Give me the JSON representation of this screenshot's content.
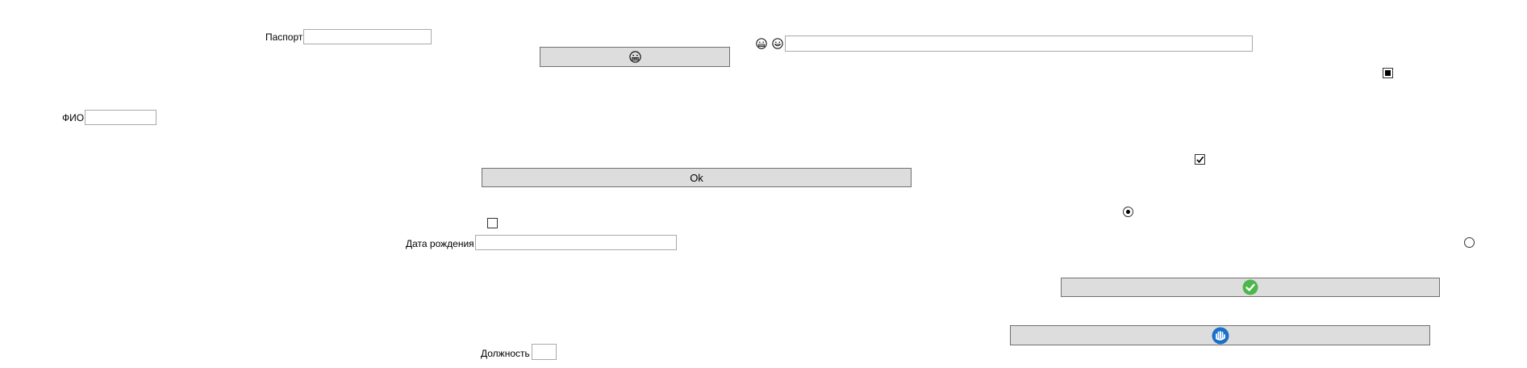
{
  "form": {
    "passport_label": "Паспорт",
    "passport_value": "",
    "fio_label": "ФИО",
    "fio_value": "",
    "birthdate_label": "Дата рождения",
    "birthdate_value": "",
    "position_label": "Должность",
    "position_value": "",
    "top_text_value": ""
  },
  "buttons": {
    "ok_label": "Ok",
    "emoji_button_icon": "grimacing-face-icon",
    "check_button_icon": "green-check-circle-icon",
    "hand_button_icon": "blue-hand-circle-icon"
  },
  "indicators": {
    "top_emoji_icons": [
      "grimacing-face-icon",
      "grinning-face-icon"
    ]
  },
  "toggles": {
    "square_checkbox_checked": true,
    "tick_checkbox_checked": true,
    "empty_checkbox_checked": false,
    "radio_selected": true,
    "radio_right_selected": false
  },
  "colors": {
    "button_bg": "#dddddd",
    "button_border": "#707070",
    "field_border": "#a9a9a9",
    "accent_green": "#4cb84c",
    "accent_blue": "#1a6fc9"
  }
}
